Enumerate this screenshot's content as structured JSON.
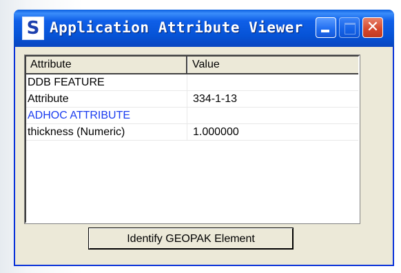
{
  "window": {
    "title": "Application Attribute Viewer",
    "icon": "geopak-s-icon",
    "icon_glyph": "S",
    "controls": {
      "minimize": "minimize-icon",
      "maximize": "maximize-icon",
      "close_glyph": "✕"
    }
  },
  "table": {
    "columns": [
      "Attribute",
      "Value"
    ],
    "rows": [
      {
        "attribute": "DDB FEATURE",
        "value": ""
      },
      {
        "attribute": "Attribute",
        "value": "334-1-13"
      },
      {
        "attribute": "ADHOC ATTRIBUTE",
        "value": ""
      },
      {
        "attribute": "thickness (Numeric)",
        "value": "1.000000"
      }
    ]
  },
  "buttons": {
    "identify": "Identify GEOPAK Element"
  },
  "colors": {
    "title_bar": "#0653d6",
    "highlight_text": "#1a3cf0",
    "dialog_bg": "#ece9d8",
    "close_button": "#d4462a"
  }
}
